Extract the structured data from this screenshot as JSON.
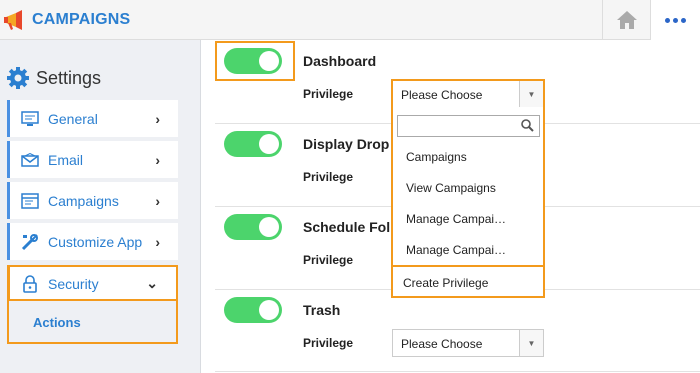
{
  "header": {
    "title": "CAMPAIGNS"
  },
  "sidebar": {
    "heading": "Settings",
    "items": [
      {
        "label": "General",
        "icon": "monitor-icon"
      },
      {
        "label": "Email",
        "icon": "envelope-icon"
      },
      {
        "label": "Campaigns",
        "icon": "browser-window-icon"
      },
      {
        "label": "Customize App",
        "icon": "tools-icon"
      },
      {
        "label": "Security",
        "icon": "lock-icon"
      }
    ],
    "sub_item": "Actions"
  },
  "rows": [
    {
      "title": "Dashboard",
      "privilege_label": "Privilege",
      "enabled": true
    },
    {
      "title": "Display Drop",
      "privilege_label": "Privilege",
      "enabled": true
    },
    {
      "title": "Schedule Fol",
      "privilege_label": "Privilege",
      "enabled": true
    },
    {
      "title": "Trash",
      "privilege_label": "Privilege",
      "enabled": true,
      "select_value": "Please Choose"
    }
  ],
  "dropdown": {
    "selected": "Please Choose",
    "search_value": "",
    "options": [
      "Campaigns",
      "View Campaigns",
      "Manage Campai…",
      "Manage Campai…"
    ],
    "create": "Create Privilege"
  },
  "colors": {
    "accent": "#2b7fd0",
    "toggle_on": "#4cd46c",
    "highlight": "#f39a1c"
  }
}
